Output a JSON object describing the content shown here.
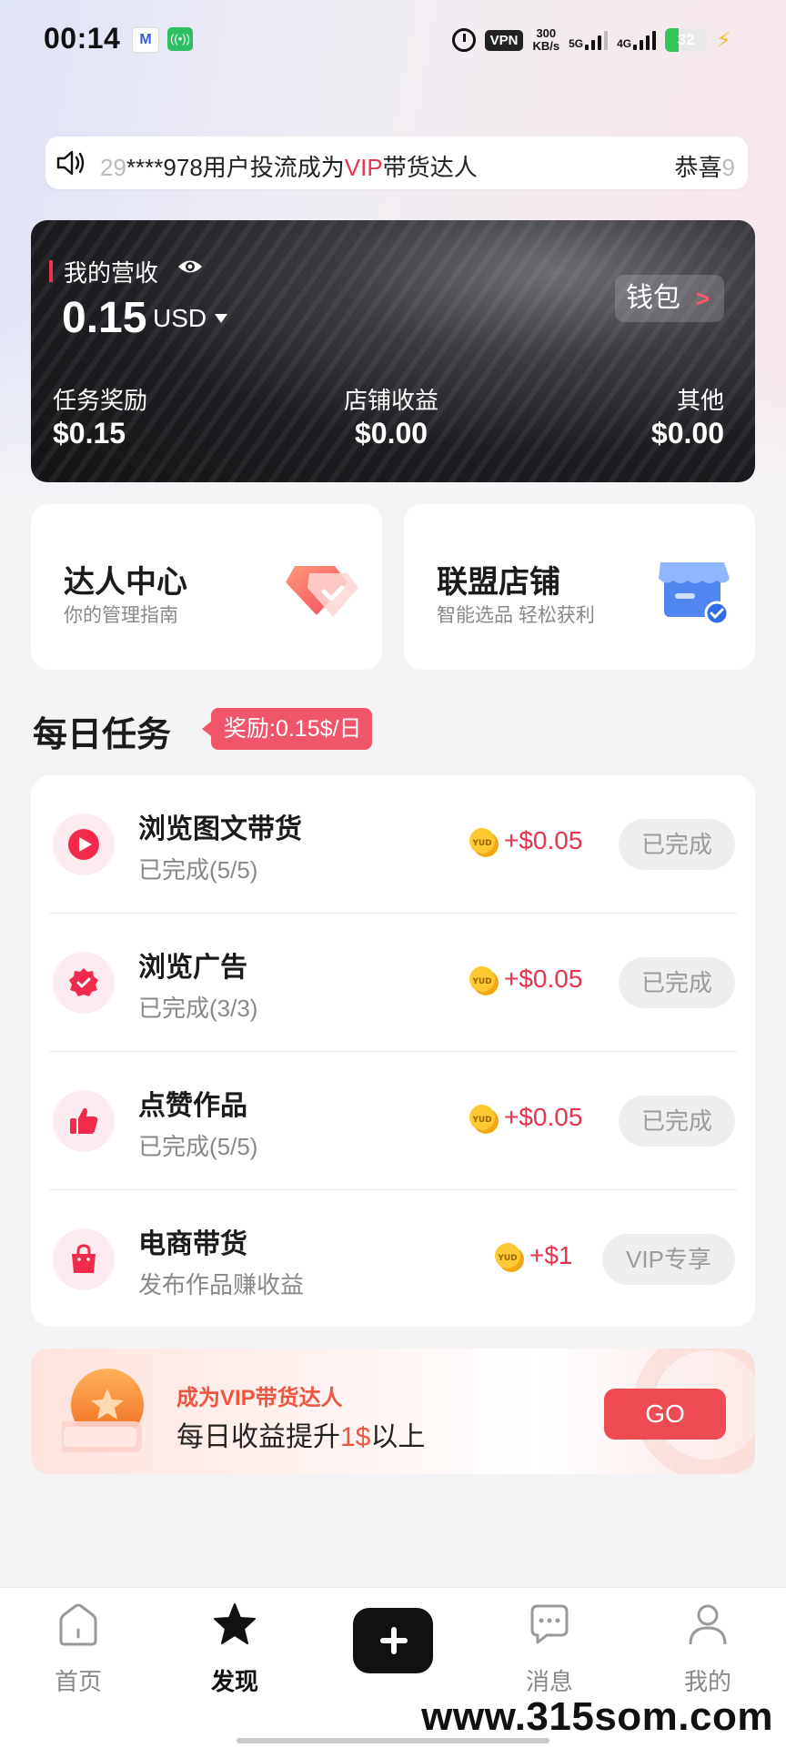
{
  "status_bar": {
    "time": "00:14",
    "vpn": "VPN",
    "speed_value": "300",
    "speed_unit": "KB/s",
    "net1": "5G",
    "net2": "4G",
    "battery": "32"
  },
  "marquee": {
    "prefix": "29",
    "text_before_vip": "****978用户投流成为",
    "vip": "VIP",
    "text_after_vip": "带货达人",
    "next": "恭喜",
    "next_fade": "9"
  },
  "revenue": {
    "title": "我的营收",
    "amount": "0.15",
    "currency": "USD",
    "wallet_label": "钱包",
    "items": [
      {
        "label": "任务奖励",
        "value": "$0.15"
      },
      {
        "label": "店铺收益",
        "value": "$0.00"
      },
      {
        "label": "其他",
        "value": "$0.00"
      }
    ]
  },
  "features": [
    {
      "title": "达人中心",
      "subtitle": "你的管理指南",
      "icon": "diamond-icon"
    },
    {
      "title": "联盟店铺",
      "subtitle": "智能选品 轻松获利",
      "icon": "store-icon"
    }
  ],
  "daily": {
    "title": "每日任务",
    "reward": "奖励:0.15$/日"
  },
  "tasks": [
    {
      "name": "浏览图文带货",
      "status": "已完成(5/5)",
      "reward": "+$0.05",
      "button": "已完成",
      "icon": "play-icon"
    },
    {
      "name": "浏览广告",
      "status": "已完成(3/3)",
      "reward": "+$0.05",
      "button": "已完成",
      "icon": "badge-check-icon"
    },
    {
      "name": "点赞作品",
      "status": "已完成(5/5)",
      "reward": "+$0.05",
      "button": "已完成",
      "icon": "thumbs-up-icon"
    },
    {
      "name": "电商带货",
      "status": "发布作品赚收益",
      "reward": "+$1",
      "button": "VIP专享",
      "icon": "shopping-bag-icon"
    }
  ],
  "coin_text": "YUD",
  "vip_banner": {
    "line1": "成为VIP带货达人",
    "line2_before": "每日收益提升",
    "line2_highlight": "1$",
    "line2_after": "以上",
    "go": "GO"
  },
  "nav": [
    {
      "label": "首页",
      "icon": "home-icon"
    },
    {
      "label": "发现",
      "icon": "star-icon"
    },
    {
      "label": "消息",
      "icon": "message-icon"
    },
    {
      "label": "我的",
      "icon": "profile-icon"
    }
  ],
  "watermark": "www.315som.com",
  "colors": {
    "accent": "#e8334d",
    "card_dark": "#1e1e22",
    "go": "#ee4b52"
  }
}
